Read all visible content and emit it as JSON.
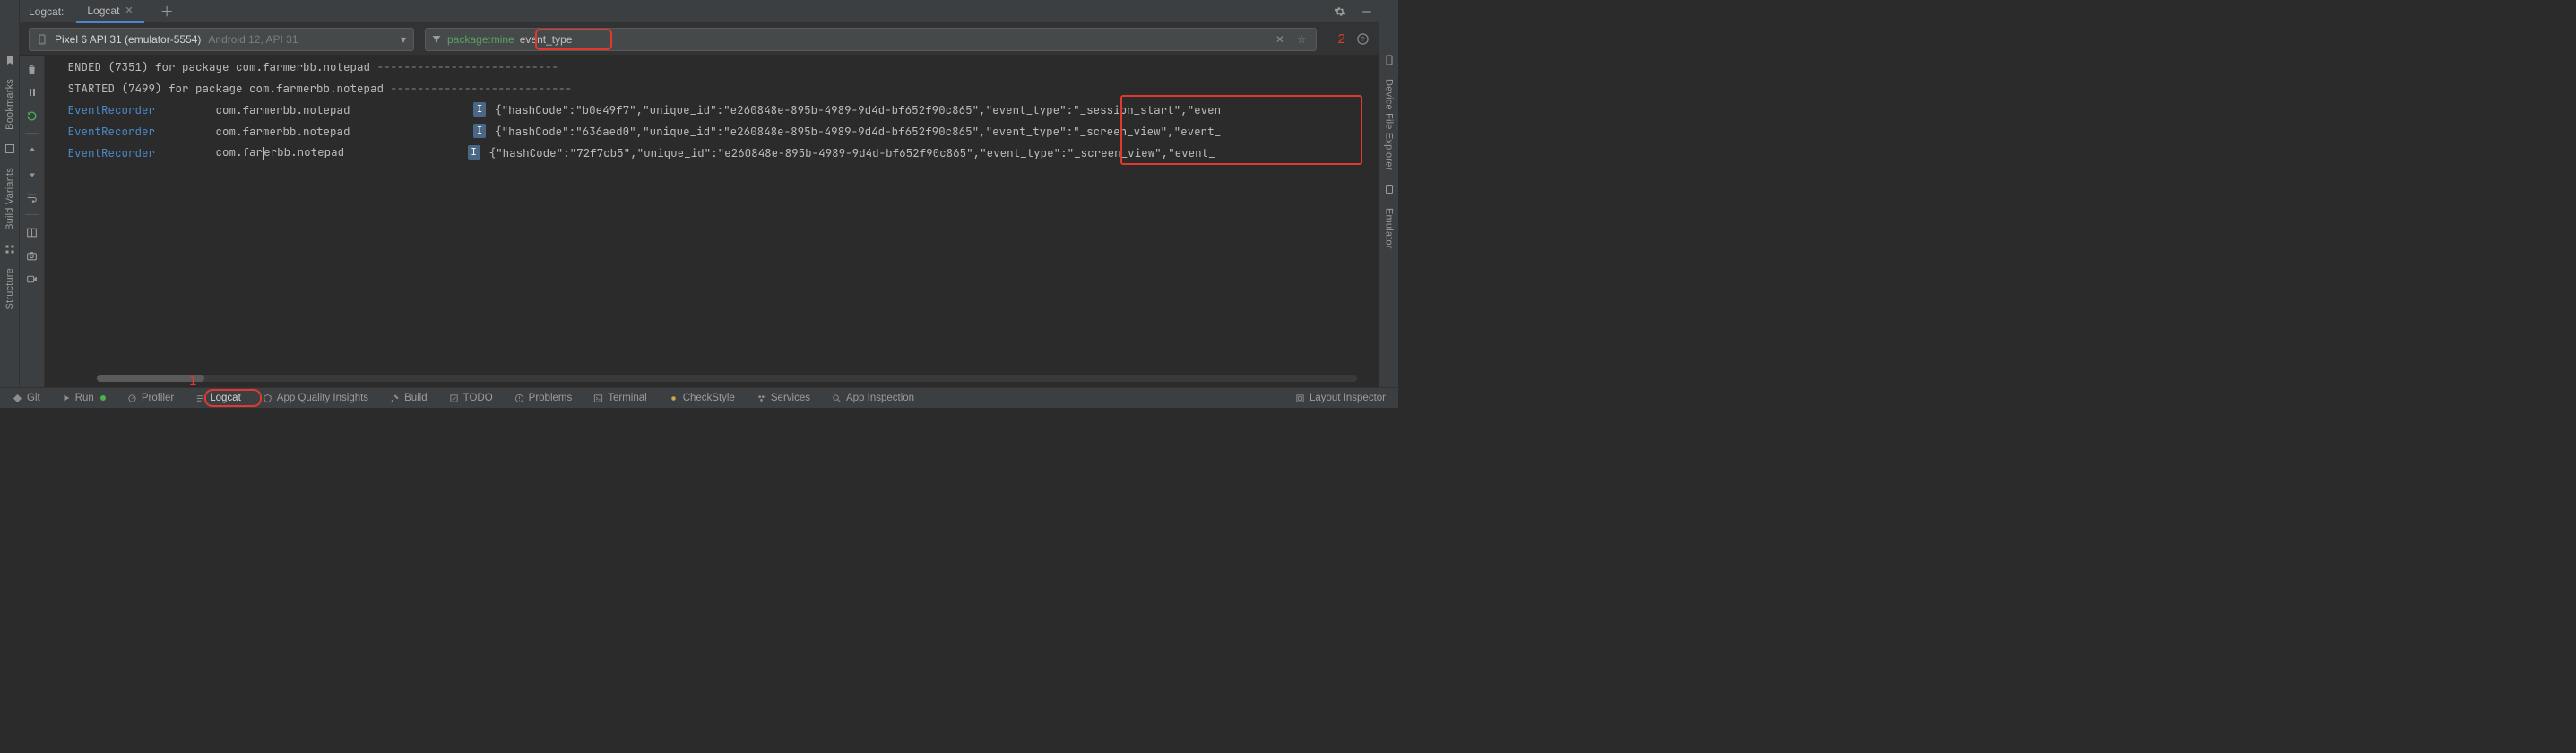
{
  "panel": {
    "title": "Logcat:"
  },
  "tabs": {
    "active": "Logcat"
  },
  "device": {
    "name": "Pixel 6 API 31 (emulator-5554)",
    "subtitle": "Android 12, API 31"
  },
  "filter": {
    "key": "package:mine",
    "text": " event_type"
  },
  "annotations": {
    "one": "1",
    "two": "2"
  },
  "log": {
    "line0": " ENDED (7351) for package com.farmerbb.notepad ",
    "dash0": "---------------------------",
    "line1": " STARTED (7499) for package com.farmerbb.notepad ",
    "dash1": "---------------------------",
    "tag": "EventRecorder",
    "pkgA": "com.farmerbb.notepad",
    "pkgB1": "com.far",
    "pkgB2": "erbb.notepad",
    "level": "I",
    "json0": "{\"hashCode\":\"b0e49f7\",\"unique_id\":\"e260848e-895b-4989-9d4d-bf652f90c865\",\"event_type\":\"_session_start\",\"even",
    "json1": "{\"hashCode\":\"636aed0\",\"unique_id\":\"e260848e-895b-4989-9d4d-bf652f90c865\",\"event_type\":\"_screen_view\",\"event_",
    "json2": "{\"hashCode\":\"72f7cb5\",\"unique_id\":\"e260848e-895b-4989-9d4d-bf652f90c865\",\"event_type\":\"_screen_view\",\"event_"
  },
  "left_rail": {
    "a": "Structure",
    "b": "Build Variants",
    "c": "Bookmarks"
  },
  "right_rail": {
    "a": "Device File Explorer",
    "b": "Emulator"
  },
  "bottom": {
    "git": "Git",
    "run": "Run",
    "profiler": "Profiler",
    "logcat": "Logcat",
    "aqi": "App Quality Insights",
    "build": "Build",
    "todo": "TODO",
    "problems": "Problems",
    "terminal": "Terminal",
    "checkstyle": "CheckStyle",
    "services": "Services",
    "appinsp": "App Inspection",
    "layout": "Layout Inspector"
  }
}
